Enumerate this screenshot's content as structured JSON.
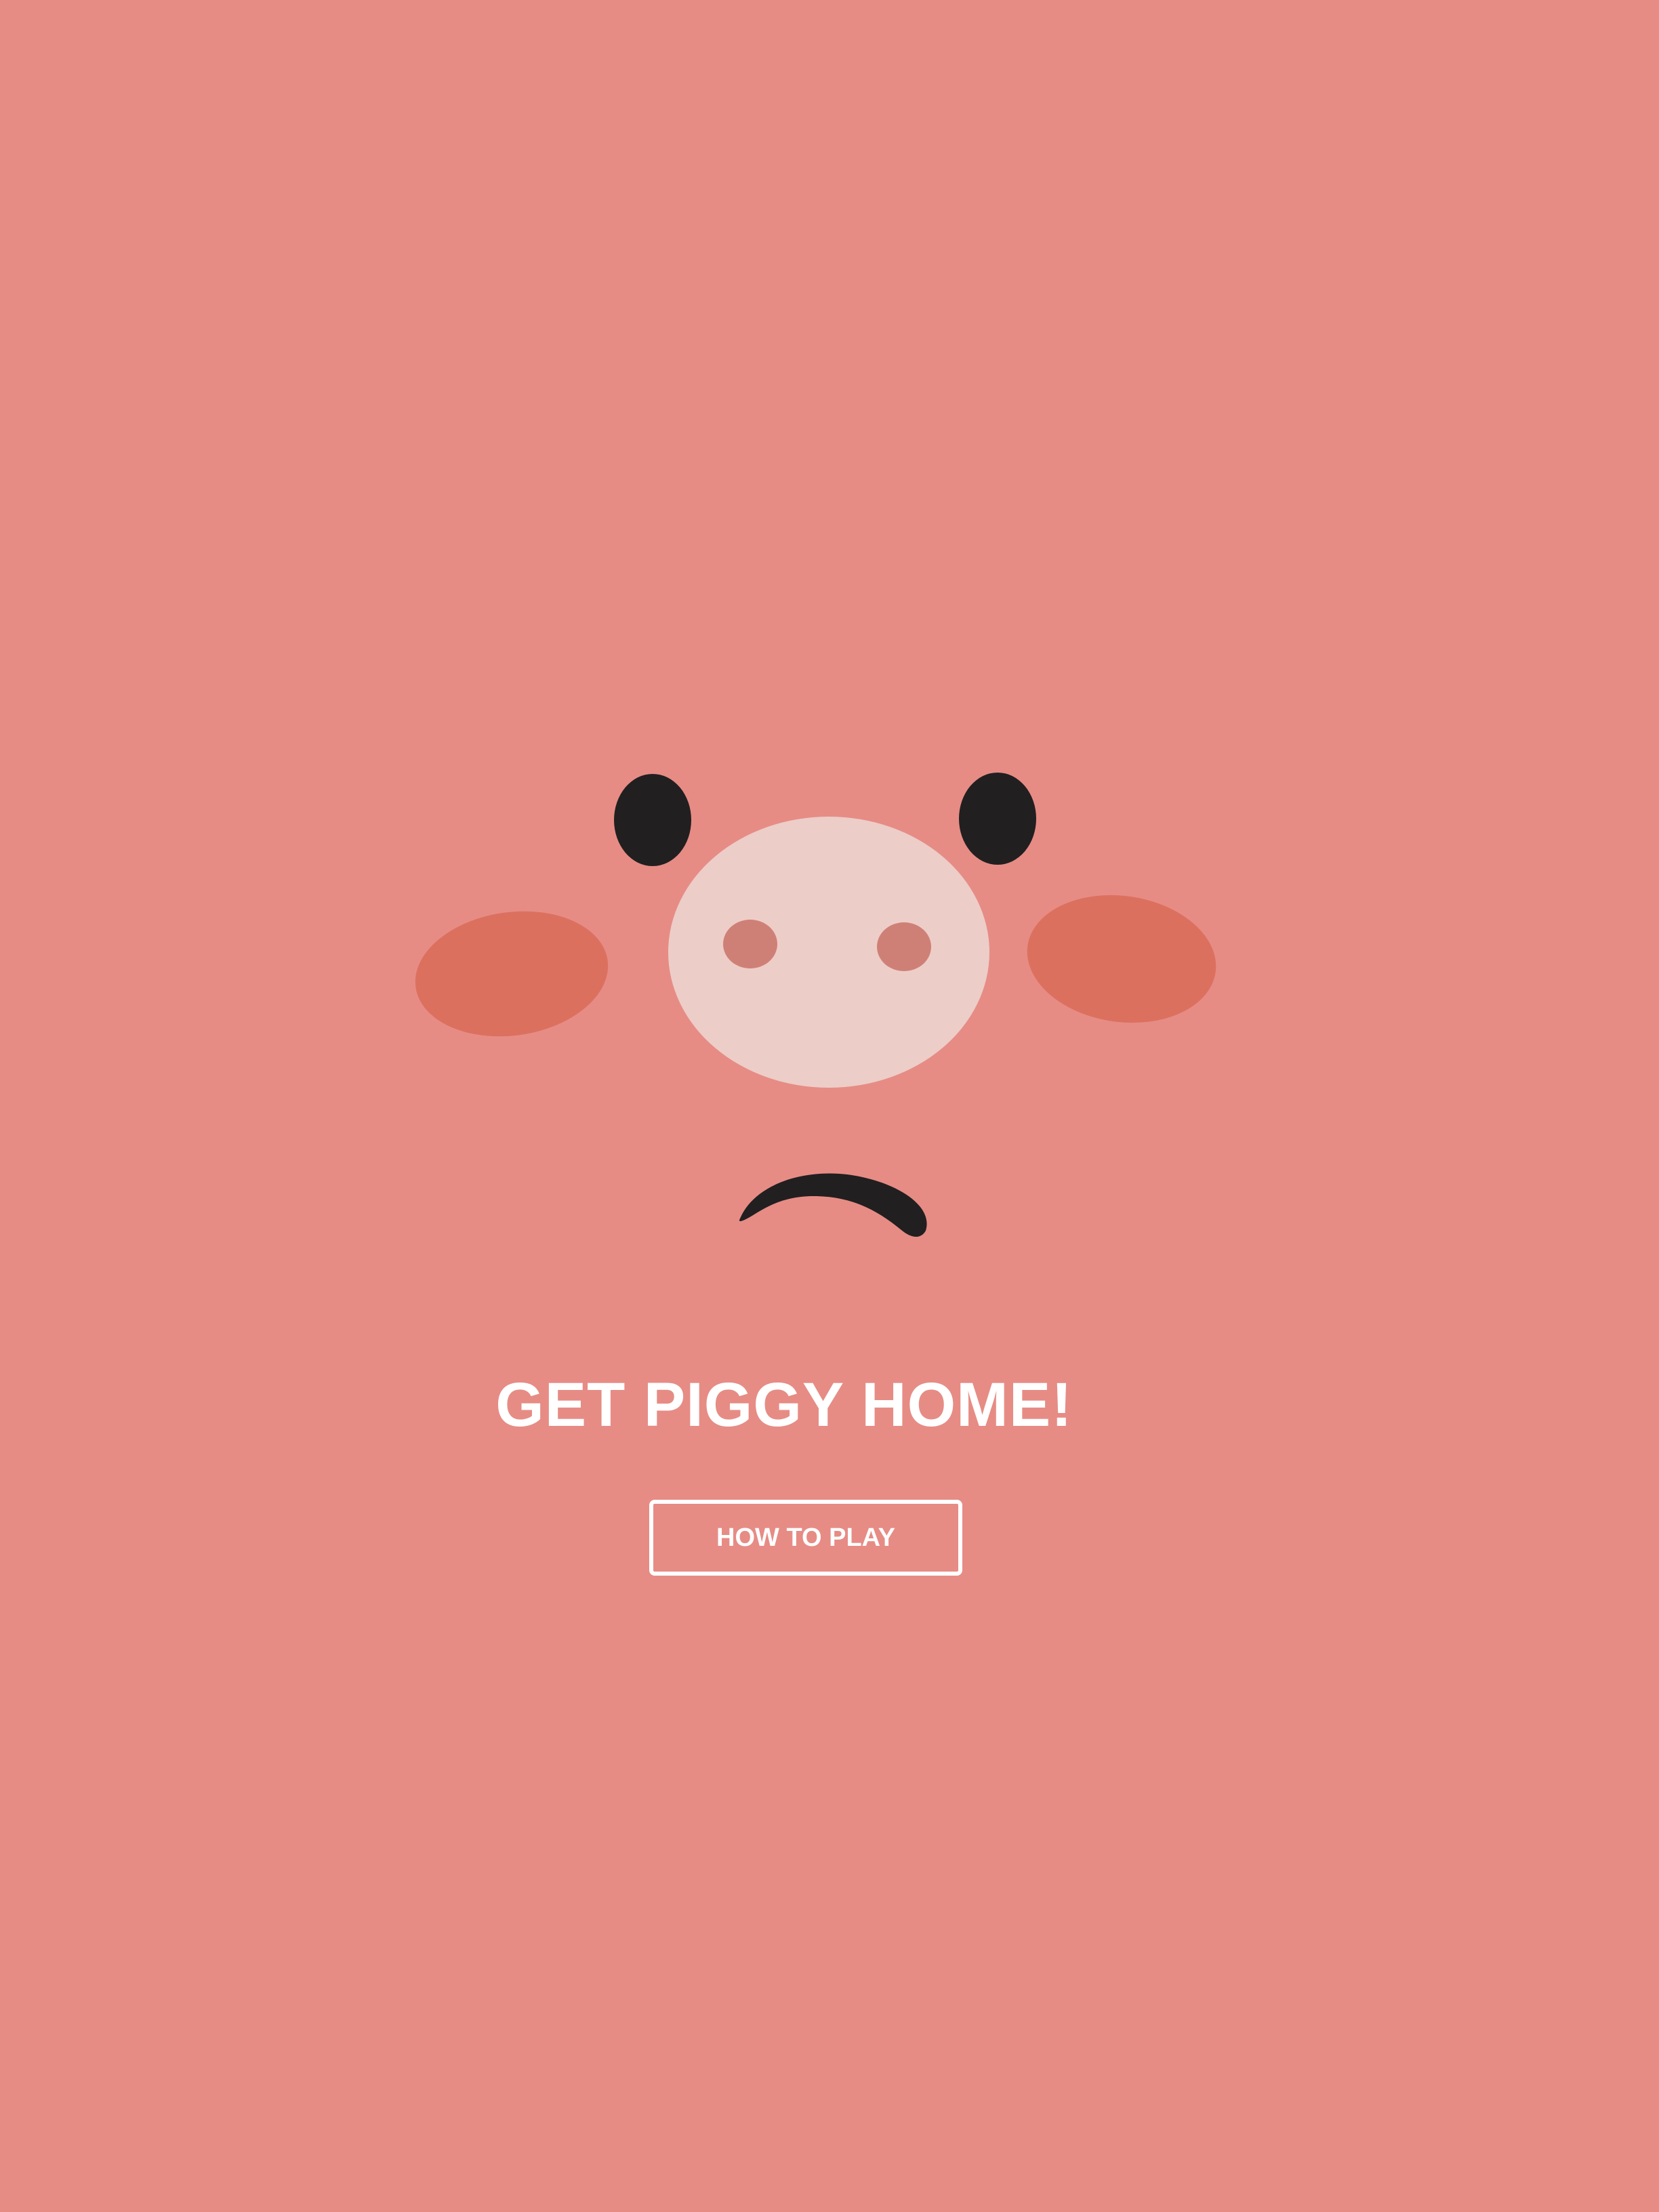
{
  "game": {
    "title": "GET PIGGY HOME!",
    "how_to_play_label": "HOW TO PLAY"
  },
  "pig": {
    "mood": "sad"
  },
  "colors": {
    "background": "#E68C85",
    "snout": "#EDCDC8",
    "nostril": "#CF8076",
    "cheek": "#DC705F",
    "eye": "#221F20",
    "mouth": "#221F20",
    "text": "#FFFFFF"
  }
}
